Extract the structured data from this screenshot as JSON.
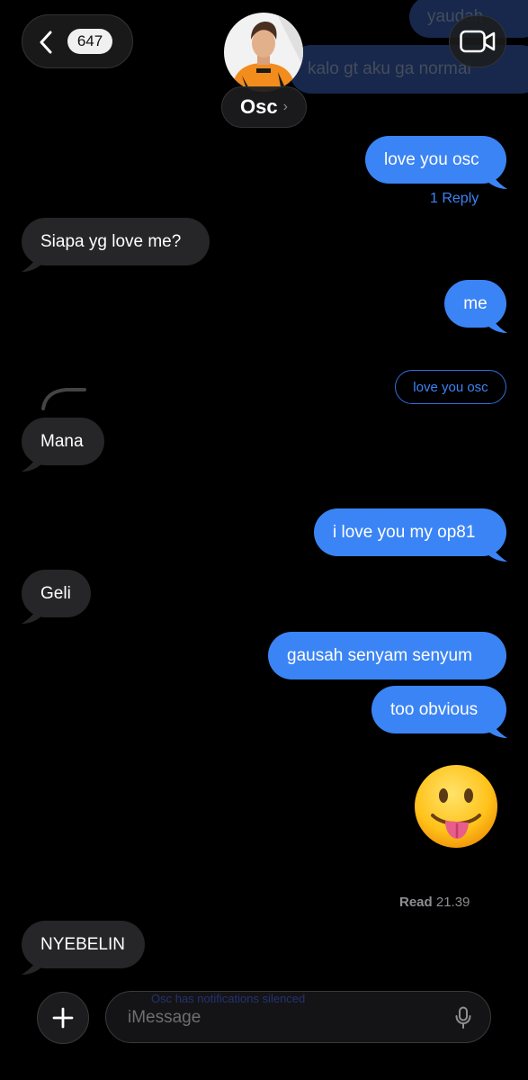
{
  "background_bubbles": [
    {
      "text": "yaudah"
    },
    {
      "text": "kalo gt aku ga normal"
    }
  ],
  "header": {
    "unread_count": "647",
    "contact_name": "Osc",
    "chevron": "›",
    "back_icon": "chevron-left-icon",
    "video_icon": "video-camera-icon"
  },
  "messages": [
    {
      "from": "me",
      "text": "love you osc"
    },
    {
      "from": "them",
      "text": "Siapa yg love me?"
    },
    {
      "from": "me",
      "text": "me"
    },
    {
      "from": "them",
      "text": "Mana"
    },
    {
      "from": "me",
      "text": "i love you my op81"
    },
    {
      "from": "them",
      "text": "Geli"
    },
    {
      "from": "me",
      "text": "gausah senyam senyum"
    },
    {
      "from": "me",
      "text": "too obvious"
    },
    {
      "from": "me",
      "text": "😛",
      "type": "emoji"
    },
    {
      "from": "them",
      "text": "NYEBELIN"
    }
  ],
  "reply_link": "1 Reply",
  "quoted_reply": "love you osc",
  "read_receipt": {
    "label": "Read",
    "time": "21.39"
  },
  "input": {
    "placeholder": "iMessage",
    "ghost_text": "Osc has notifications silenced"
  },
  "colors": {
    "outgoing": "#3b84f5",
    "incoming": "#262628",
    "background": "#000000",
    "link": "#3b84f5"
  }
}
